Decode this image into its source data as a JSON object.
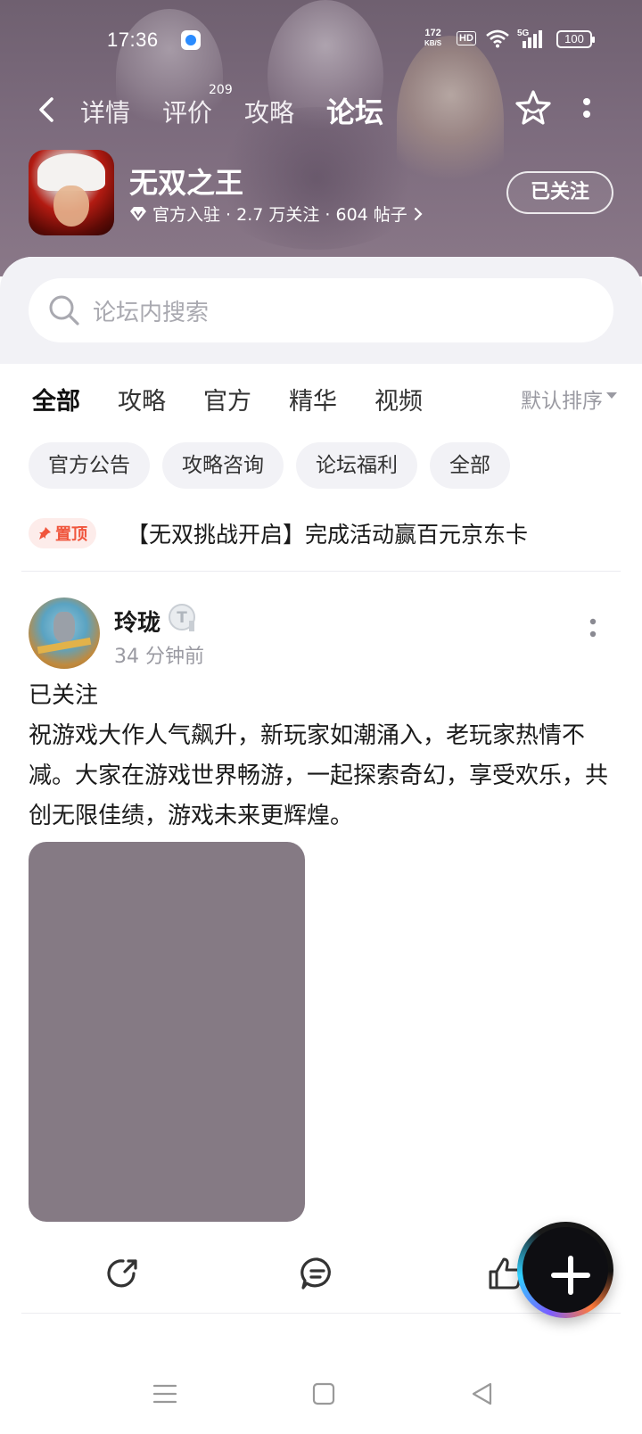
{
  "status_bar": {
    "time": "17:36",
    "net_speed_value": "172",
    "net_speed_unit": "KB/S",
    "hd": "HD",
    "signal": "5G",
    "battery": "100",
    "icons": [
      "app-notification-icon",
      "wifi-icon",
      "signal-icon",
      "battery-icon"
    ]
  },
  "nav": {
    "tabs": [
      {
        "label": "详情"
      },
      {
        "label": "评价",
        "badge": "209"
      },
      {
        "label": "攻略"
      },
      {
        "label": "论坛",
        "active": true
      }
    ],
    "icons": [
      "back-icon",
      "star-icon",
      "more-icon"
    ]
  },
  "game": {
    "name": "无双之王",
    "meta": "官方入驻 · 2.7 万关注 · 604 帖子",
    "follow_label": "已关注"
  },
  "search": {
    "placeholder": "论坛内搜索"
  },
  "filter_tabs": [
    {
      "label": "全部",
      "active": true
    },
    {
      "label": "攻略"
    },
    {
      "label": "官方"
    },
    {
      "label": "精华"
    },
    {
      "label": "视频"
    }
  ],
  "sort_label": "默认排序",
  "chips": [
    "官方公告",
    "攻略咨询",
    "论坛福利",
    "全部"
  ],
  "pinned": {
    "badge": "置顶",
    "title": "【无双挑战开启】完成活动赢百元京东卡"
  },
  "post": {
    "author": "玲珑",
    "level_badge": "T",
    "time_ago": "34 分钟前",
    "text_line1": "已关注",
    "text_body": "祝游戏大作人气飙升，新玩家如潮涌入，老玩家热情不减。大家在游戏世界畅游，一起探索奇幻，享受欢乐，共创无限佳绩，游戏未来更辉煌。",
    "actions": [
      "share-icon",
      "comment-icon",
      "like-icon"
    ]
  },
  "colors": {
    "accent": "#1fd0b4",
    "banner": "#7c6b7d",
    "pin_red": "#f0553c",
    "image_placeholder": "#857a84"
  }
}
